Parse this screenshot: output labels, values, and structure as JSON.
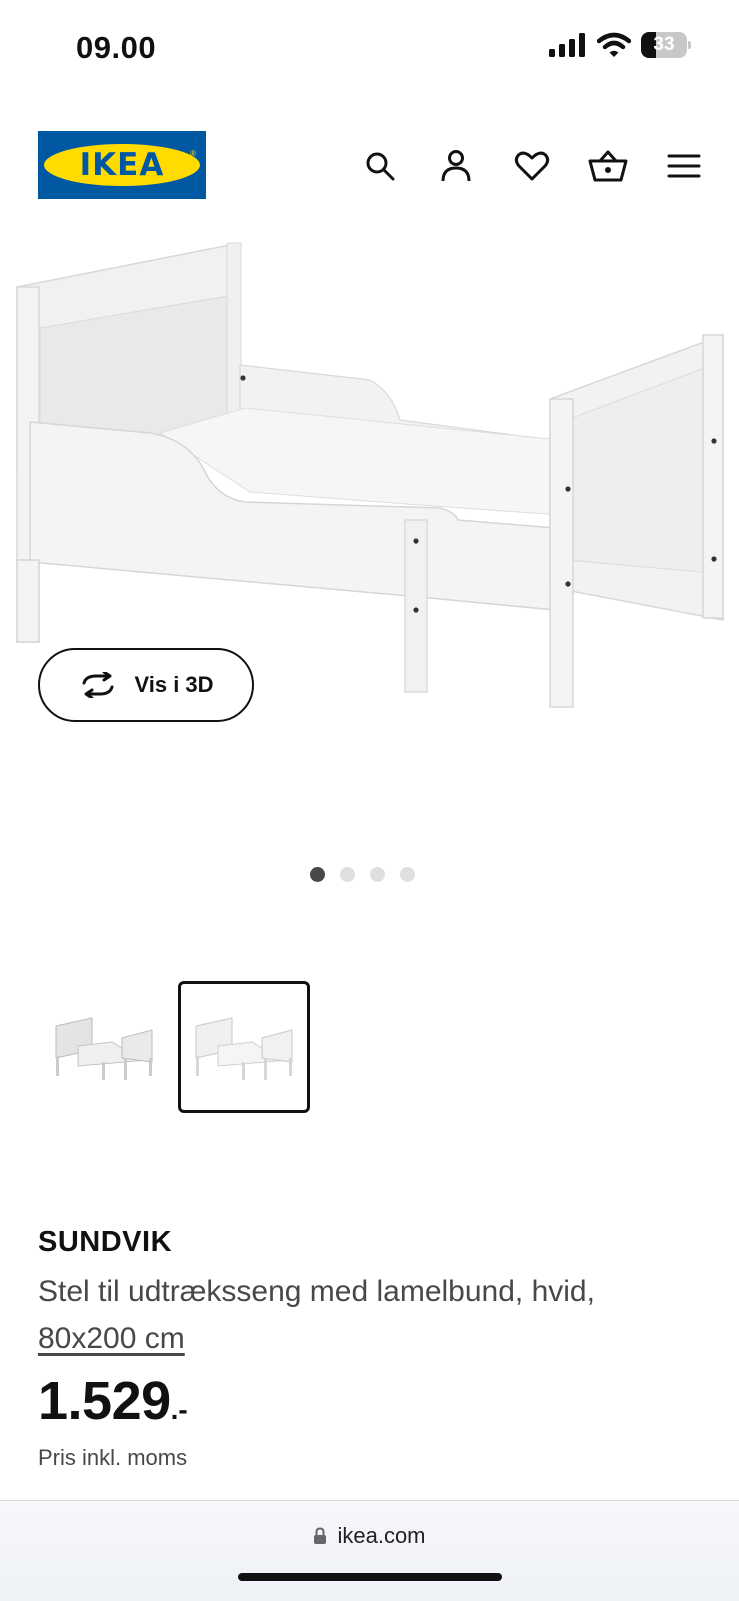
{
  "status_bar": {
    "time": "09.00",
    "battery_level": "33",
    "icons": [
      "cellular-signal-icon",
      "wifi-icon",
      "battery-icon"
    ]
  },
  "header": {
    "logo_text": "IKEA",
    "nav_icons": [
      "search-icon",
      "account-icon",
      "heart-icon",
      "cart-icon",
      "menu-icon"
    ]
  },
  "gallery": {
    "view_3d_label": "Vis i 3D",
    "dot_count": 4,
    "active_dot": 1,
    "thumbnail_count": 2,
    "selected_thumbnail": 2
  },
  "product": {
    "name": "SUNDVIK",
    "description": "Stel til udtræksseng med lamelbund, hvid,",
    "size": "80x200 cm",
    "price_integer": "1.529",
    "price_suffix": ".-",
    "vat_note": "Pris inkl. moms"
  },
  "browser": {
    "url": "ikea.com"
  },
  "colors": {
    "brand_blue": "#0058a3",
    "brand_yellow": "#ffdb00",
    "text_primary": "#111111",
    "text_secondary": "#484848"
  }
}
